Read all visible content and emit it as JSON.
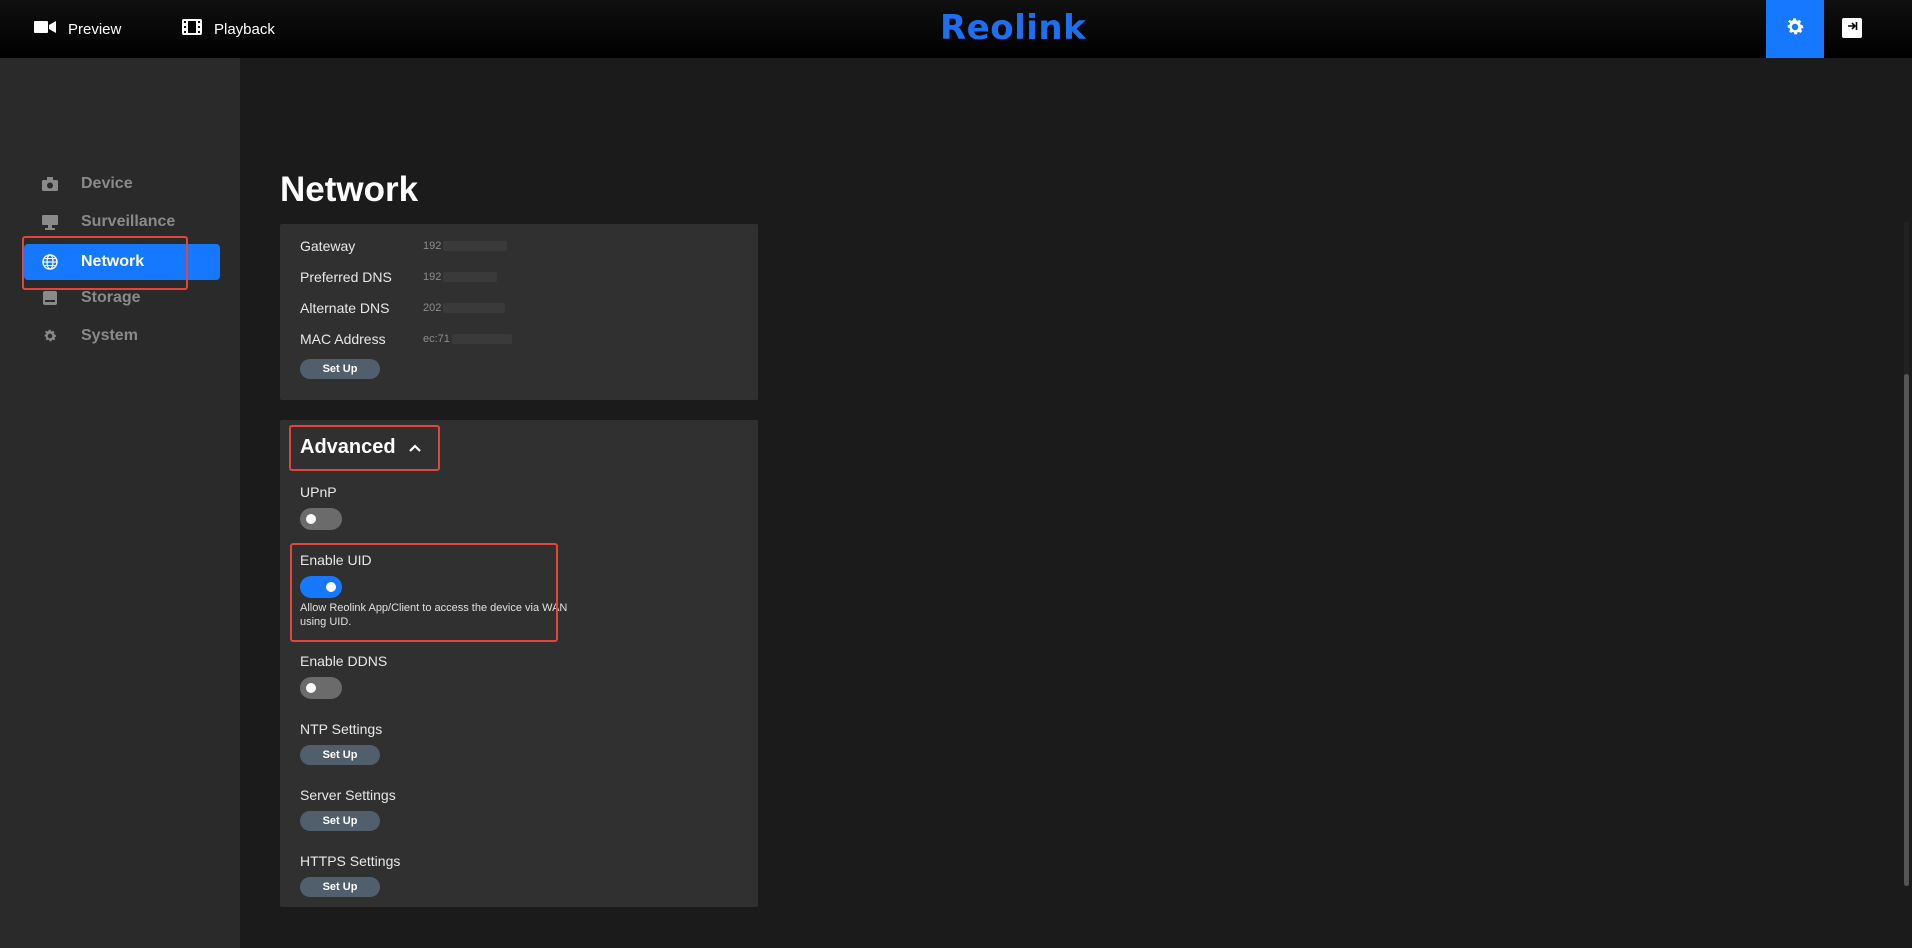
{
  "nav": {
    "preview_label": "Preview",
    "playback_label": "Playback",
    "logo_text": "Reolink",
    "accent_color": "#1677ff"
  },
  "sidebar": {
    "items": [
      {
        "label": "Device",
        "icon": "camera-icon"
      },
      {
        "label": "Surveillance",
        "icon": "monitor-icon"
      },
      {
        "label": "Network",
        "icon": "globe-icon",
        "active": true
      },
      {
        "label": "Storage",
        "icon": "storage-icon"
      },
      {
        "label": "System",
        "icon": "gear-icon"
      }
    ]
  },
  "page": {
    "title": "Network"
  },
  "network_info": {
    "rows": [
      {
        "label": "Gateway",
        "value": "192"
      },
      {
        "label": "Preferred DNS",
        "value": "192"
      },
      {
        "label": "Alternate DNS",
        "value": "202"
      },
      {
        "label": "MAC Address",
        "value": "ec:71"
      }
    ],
    "setup_label": "Set Up"
  },
  "advanced": {
    "title": "Advanced",
    "upnp": {
      "label": "UPnP",
      "enabled": false
    },
    "uid": {
      "label": "Enable UID",
      "enabled": true,
      "description": "Allow Reolink App/Client to access the device via WAN using UID."
    },
    "ddns": {
      "label": "Enable DDNS",
      "enabled": false
    },
    "ntp": {
      "label": "NTP Settings",
      "button": "Set Up"
    },
    "server": {
      "label": "Server Settings",
      "button": "Set Up"
    },
    "https": {
      "label": "HTTPS Settings",
      "button": "Set Up"
    }
  }
}
